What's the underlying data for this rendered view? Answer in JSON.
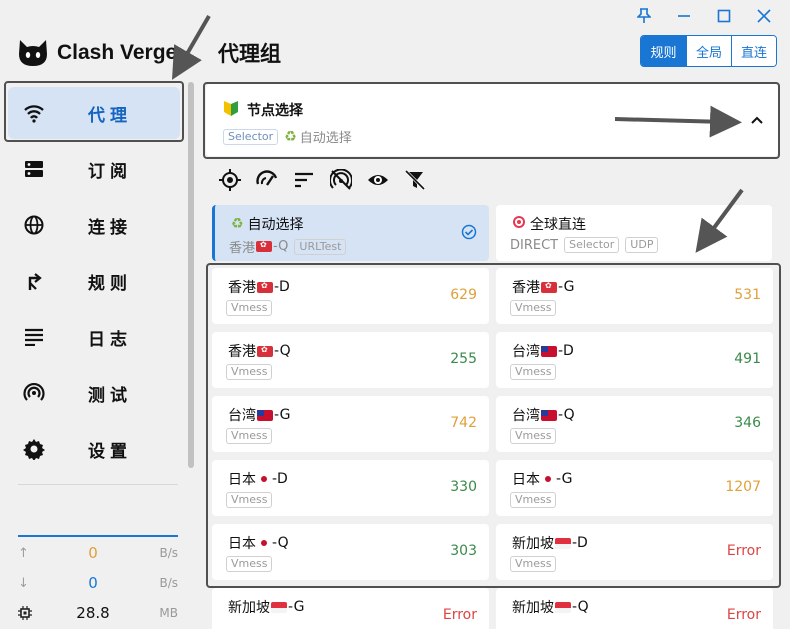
{
  "app": {
    "name": "Clash Verge"
  },
  "sidebar": {
    "items": [
      {
        "label": "代理",
        "icon": "wifi-icon",
        "active": true
      },
      {
        "label": "订阅",
        "icon": "dns-icon",
        "active": false
      },
      {
        "label": "连接",
        "icon": "globe-icon",
        "active": false
      },
      {
        "label": "规则",
        "icon": "fork-right-icon",
        "active": false
      },
      {
        "label": "日志",
        "icon": "list-lines-icon",
        "active": false
      },
      {
        "label": "测试",
        "icon": "broadcast-icon",
        "active": false
      },
      {
        "label": "设置",
        "icon": "gear-icon",
        "active": false
      }
    ],
    "traffic": {
      "upload": {
        "value": "0",
        "unit": "B/s"
      },
      "download": {
        "value": "0",
        "unit": "B/s"
      },
      "memory": {
        "value": "28.8",
        "unit": "MB"
      }
    }
  },
  "header": {
    "title": "代理组",
    "modes": [
      {
        "label": "规则",
        "active": true
      },
      {
        "label": "全局",
        "active": false
      },
      {
        "label": "直连",
        "active": false
      }
    ]
  },
  "group": {
    "name": "节点选择",
    "type": "Selector",
    "current": "自动选择"
  },
  "toolbar": [
    "locate-icon",
    "speed-test-icon",
    "sort-icon",
    "hide-unavailable-icon",
    "eye-icon",
    "filter-off-icon"
  ],
  "proxies": [
    {
      "name": "自动选择",
      "sub": "香港",
      "subFlag": "hk",
      "subSuffix": "-Q",
      "tags": [
        "URLTest"
      ],
      "delay": "",
      "selected": true
    },
    {
      "name": "全球直连",
      "sub": "DIRECT",
      "subFlag": "",
      "subSuffix": "",
      "tags": [
        "Selector",
        "UDP"
      ],
      "delay": "",
      "selected": false
    },
    {
      "name": "香港",
      "flag": "hk",
      "suffix": "-D",
      "tags": [
        "Vmess"
      ],
      "delay": "629",
      "delayColor": "orange"
    },
    {
      "name": "香港",
      "flag": "hk",
      "suffix": "-G",
      "tags": [
        "Vmess"
      ],
      "delay": "531",
      "delayColor": "orange"
    },
    {
      "name": "香港",
      "flag": "hk",
      "suffix": "-Q",
      "tags": [
        "Vmess"
      ],
      "delay": "255",
      "delayColor": "green"
    },
    {
      "name": "台湾",
      "flag": "tw",
      "suffix": "-D",
      "tags": [
        "Vmess"
      ],
      "delay": "491",
      "delayColor": "green"
    },
    {
      "name": "台湾",
      "flag": "tw",
      "suffix": "-G",
      "tags": [
        "Vmess"
      ],
      "delay": "742",
      "delayColor": "orange"
    },
    {
      "name": "台湾",
      "flag": "tw",
      "suffix": "-Q",
      "tags": [
        "Vmess"
      ],
      "delay": "346",
      "delayColor": "green"
    },
    {
      "name": "日本",
      "flag": "jp",
      "suffix": "-D",
      "tags": [
        "Vmess"
      ],
      "delay": "330",
      "delayColor": "green"
    },
    {
      "name": "日本",
      "flag": "jp",
      "suffix": "-G",
      "tags": [
        "Vmess"
      ],
      "delay": "1207",
      "delayColor": "orange"
    },
    {
      "name": "日本",
      "flag": "jp",
      "suffix": "-Q",
      "tags": [
        "Vmess"
      ],
      "delay": "303",
      "delayColor": "green"
    },
    {
      "name": "新加坡",
      "flag": "sg",
      "suffix": "-D",
      "tags": [
        "Vmess"
      ],
      "delay": "Error",
      "delayColor": "red"
    },
    {
      "name": "新加坡",
      "flag": "sg",
      "suffix": "-G",
      "tags": [],
      "delay": "Error",
      "delayColor": "red"
    },
    {
      "name": "新加坡",
      "flag": "sg",
      "suffix": "-Q",
      "tags": [],
      "delay": "Error",
      "delayColor": "red"
    }
  ],
  "colors": {
    "accent": "#1976d2",
    "selected_bg": "#d5e3f5",
    "annotation": "#505050"
  }
}
